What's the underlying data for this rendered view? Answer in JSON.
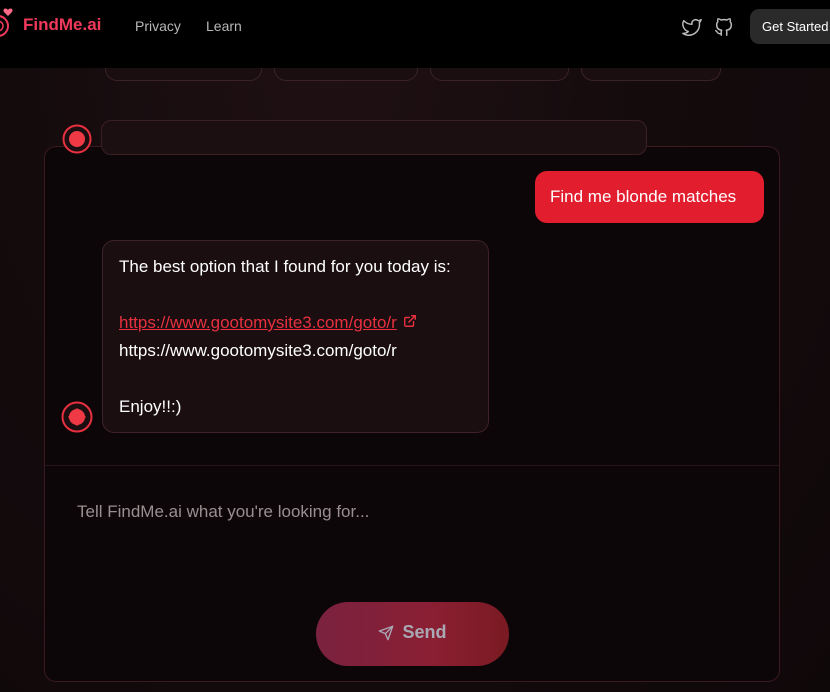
{
  "header": {
    "logo_text": "FindMe.ai",
    "nav": [
      {
        "label": "Privacy"
      },
      {
        "label": "Learn"
      }
    ],
    "icons": [
      "twitter-icon",
      "github-icon"
    ],
    "cta_label": "Get Started"
  },
  "chat": {
    "user_message": "Find me blonde matches",
    "bot_message": {
      "line1": "The best option that I found for you today is:",
      "link_text": "https://www.gootomysite3.com/goto/r",
      "plain_text": "https://www.gootomysite3.com/goto/r",
      "closing": "Enjoy!!:)"
    }
  },
  "composer": {
    "placeholder": "Tell FindMe.ai what you're looking for...",
    "send_label": "Send"
  },
  "colors": {
    "brand": "#f0395b",
    "user_bubble": "#e11d2e",
    "link": "#e8303f",
    "background": "#120a0c"
  }
}
